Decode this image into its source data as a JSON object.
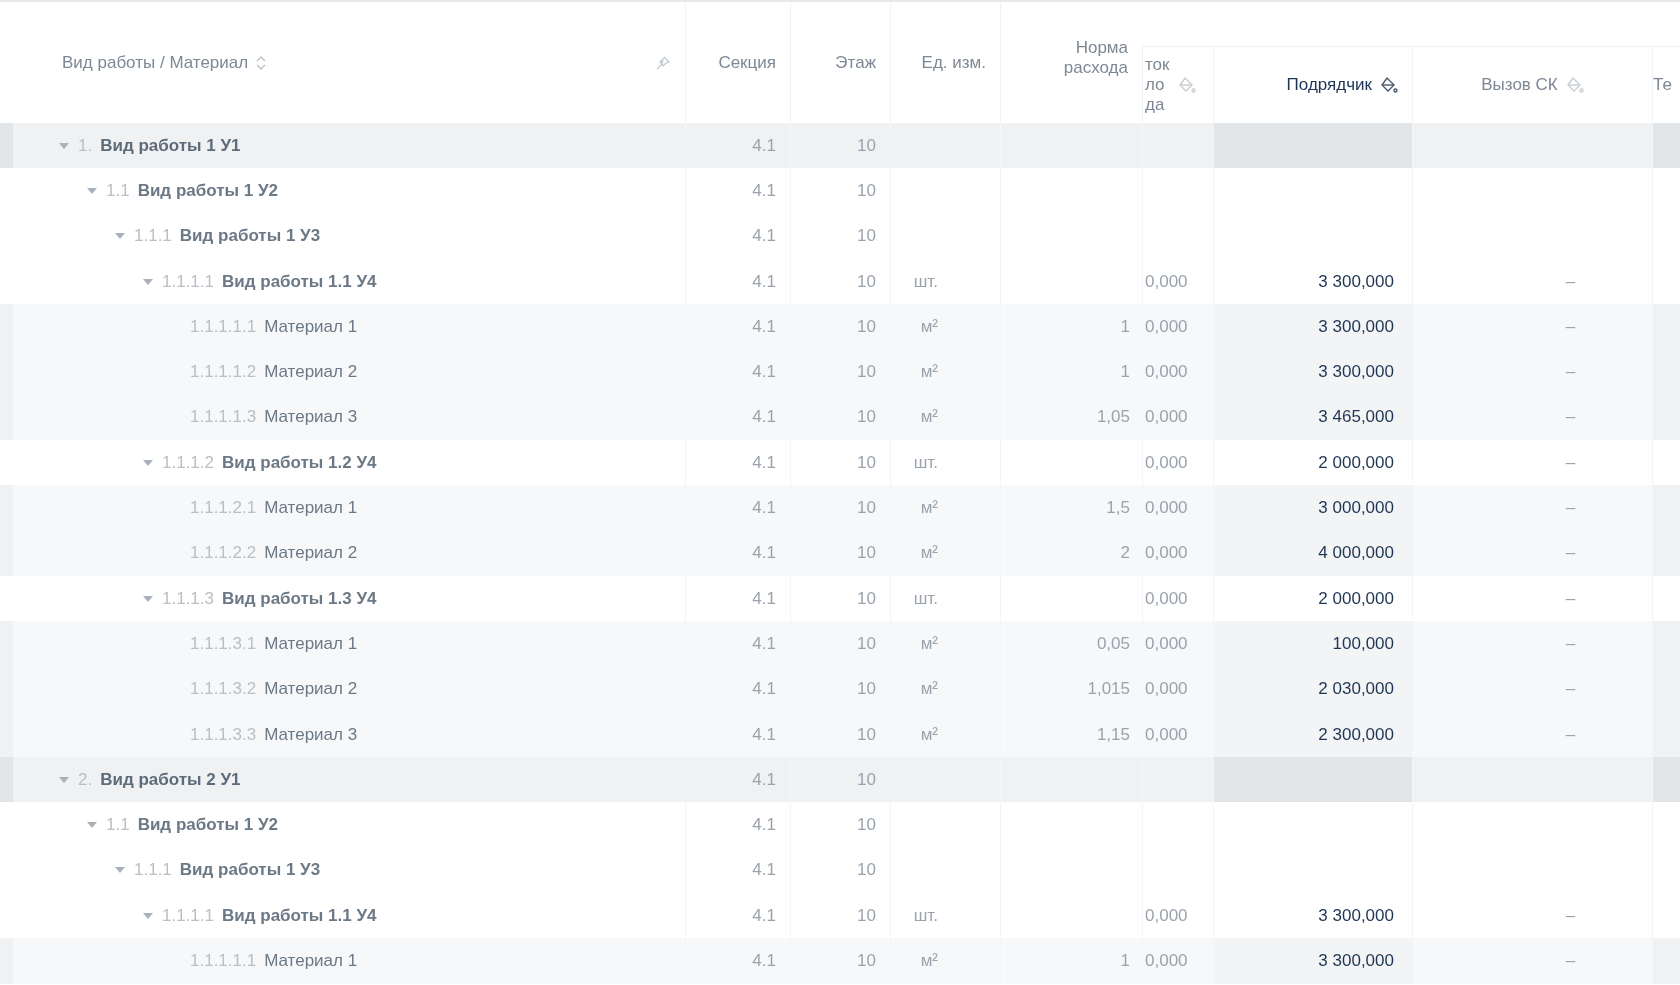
{
  "table": {
    "columns": [
      {
        "label": "Вид работы / Материал",
        "sortable": true,
        "pinned": true,
        "highlighted": false
      },
      {
        "label": "Секция",
        "highlighted": false
      },
      {
        "label": "Этаж",
        "highlighted": false
      },
      {
        "label": "Ед. изм.",
        "highlighted": false
      },
      {
        "label": "Норма\nрасхода",
        "highlighted": false
      },
      {
        "label": "ток\nло\nда",
        "filterable": true,
        "highlighted": false
      },
      {
        "label": "Подрядчик",
        "filterable": true,
        "highlighted": true
      },
      {
        "label": "Вызов СК",
        "filterable": true,
        "highlighted": false
      },
      {
        "label": "Те",
        "highlighted": false
      }
    ],
    "rows": [
      {
        "kind": "section",
        "number": "1.",
        "name": "Вид работы 1 У1",
        "expanded": true,
        "section": "4.1",
        "floor": "10",
        "children": [
          {
            "kind": "work",
            "number": "1.1",
            "name": "Вид работы 1 У2",
            "expanded": true,
            "section": "4.1",
            "floor": "10",
            "children": [
              {
                "kind": "work",
                "number": "1.1.1",
                "name": "Вид работы 1 У3",
                "expanded": true,
                "section": "4.1",
                "floor": "10",
                "children": [
                  {
                    "kind": "work",
                    "number": "1.1.1.1",
                    "name": "Вид работы 1.1 У4",
                    "expanded": true,
                    "section": "4.1",
                    "floor": "10",
                    "unit": "шт.",
                    "balance": "0,000",
                    "contractor": "3 300,000",
                    "sk_call": "–",
                    "children": [
                      {
                        "kind": "material",
                        "number": "1.1.1.1.1",
                        "name": "Материал 1",
                        "section": "4.1",
                        "floor": "10",
                        "unit": "м²",
                        "rate": "1",
                        "balance": "0,000",
                        "contractor": "3 300,000",
                        "sk_call": "–"
                      },
                      {
                        "kind": "material",
                        "number": "1.1.1.1.2",
                        "name": "Материал 2",
                        "section": "4.1",
                        "floor": "10",
                        "unit": "м²",
                        "rate": "1",
                        "balance": "0,000",
                        "contractor": "3 300,000",
                        "sk_call": "–"
                      },
                      {
                        "kind": "material",
                        "number": "1.1.1.1.3",
                        "name": "Материал 3",
                        "section": "4.1",
                        "floor": "10",
                        "unit": "м²",
                        "rate": "1,05",
                        "balance": "0,000",
                        "contractor": "3 465,000",
                        "sk_call": "–"
                      }
                    ]
                  },
                  {
                    "kind": "work",
                    "number": "1.1.1.2",
                    "name": "Вид работы 1.2 У4",
                    "expanded": true,
                    "section": "4.1",
                    "floor": "10",
                    "unit": "шт.",
                    "balance": "0,000",
                    "contractor": "2 000,000",
                    "sk_call": "–",
                    "children": [
                      {
                        "kind": "material",
                        "number": "1.1.1.2.1",
                        "name": "Материал 1",
                        "section": "4.1",
                        "floor": "10",
                        "unit": "м²",
                        "rate": "1,5",
                        "balance": "0,000",
                        "contractor": "3 000,000",
                        "sk_call": "–"
                      },
                      {
                        "kind": "material",
                        "number": "1.1.1.2.2",
                        "name": "Материал 2",
                        "section": "4.1",
                        "floor": "10",
                        "unit": "м²",
                        "rate": "2",
                        "balance": "0,000",
                        "contractor": "4 000,000",
                        "sk_call": "–"
                      }
                    ]
                  },
                  {
                    "kind": "work",
                    "number": "1.1.1.3",
                    "name": "Вид работы 1.3 У4",
                    "expanded": true,
                    "section": "4.1",
                    "floor": "10",
                    "unit": "шт.",
                    "balance": "0,000",
                    "contractor": "2 000,000",
                    "sk_call": "–",
                    "children": [
                      {
                        "kind": "material",
                        "number": "1.1.1.3.1",
                        "name": "Материал 1",
                        "section": "4.1",
                        "floor": "10",
                        "unit": "м²",
                        "rate": "0,05",
                        "balance": "0,000",
                        "contractor": "100,000",
                        "sk_call": "–"
                      },
                      {
                        "kind": "material",
                        "number": "1.1.1.3.2",
                        "name": "Материал 2",
                        "section": "4.1",
                        "floor": "10",
                        "unit": "м²",
                        "rate": "1,015",
                        "balance": "0,000",
                        "contractor": "2 030,000",
                        "sk_call": "–"
                      },
                      {
                        "kind": "material",
                        "number": "1.1.1.3.3",
                        "name": "Материал 3",
                        "section": "4.1",
                        "floor": "10",
                        "unit": "м²",
                        "rate": "1,15",
                        "balance": "0,000",
                        "contractor": "2 300,000",
                        "sk_call": "–"
                      }
                    ]
                  }
                ]
              }
            ]
          }
        ]
      },
      {
        "kind": "section",
        "number": "2.",
        "name": "Вид работы 2 У1",
        "expanded": true,
        "section": "4.1",
        "floor": "10",
        "children": [
          {
            "kind": "work",
            "number": "1.1",
            "name": "Вид работы 1 У2",
            "expanded": true,
            "section": "4.1",
            "floor": "10",
            "children": [
              {
                "kind": "work",
                "number": "1.1.1",
                "name": "Вид работы 1 У3",
                "expanded": true,
                "section": "4.1",
                "floor": "10",
                "children": [
                  {
                    "kind": "work",
                    "number": "1.1.1.1",
                    "name": "Вид работы 1.1 У4",
                    "expanded": true,
                    "section": "4.1",
                    "floor": "10",
                    "unit": "шт.",
                    "balance": "0,000",
                    "contractor": "3 300,000",
                    "sk_call": "–",
                    "children": [
                      {
                        "kind": "material",
                        "number": "1.1.1.1.1",
                        "name": "Материал 1",
                        "section": "4.1",
                        "floor": "10",
                        "unit": "м²",
                        "rate": "1",
                        "balance": "0,000",
                        "contractor": "3 300,000",
                        "sk_call": "–"
                      }
                    ]
                  }
                ]
              }
            ]
          }
        ]
      }
    ]
  }
}
